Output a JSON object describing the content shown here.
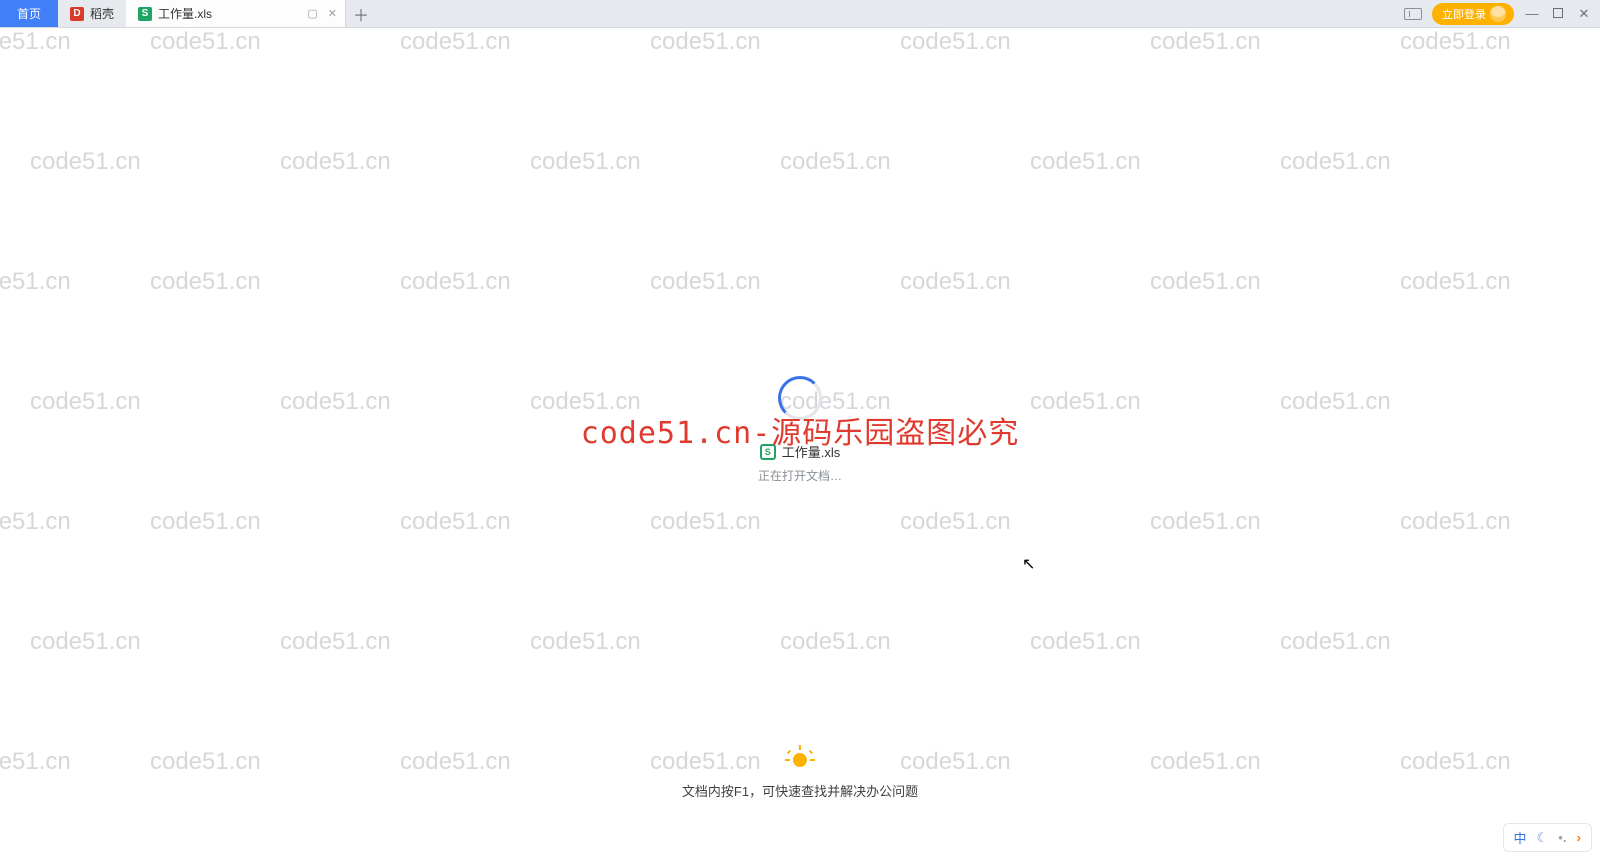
{
  "tabs": {
    "home": "首页",
    "docer": "稻壳",
    "file_name": "工作量.xls"
  },
  "titlebar": {
    "login_label": "立即登录"
  },
  "loading": {
    "file_name": "工作量.xls",
    "status": "正在打开文档…"
  },
  "tip": {
    "text": "文档内按F1，可快速查找并解决办公问题"
  },
  "watermark": {
    "text": "code51.cn",
    "center_text": "code51.cn-源码乐园盗图必究"
  },
  "ime": {
    "lang": "中"
  }
}
